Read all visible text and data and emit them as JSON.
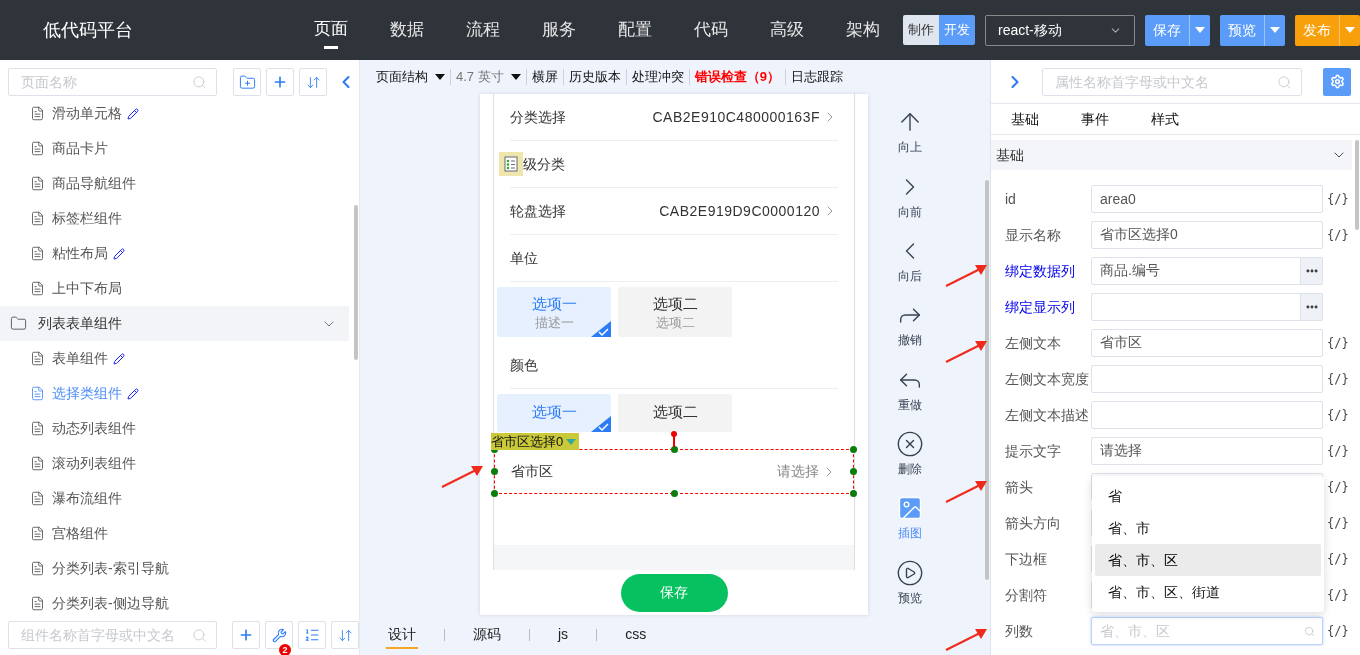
{
  "app": {
    "title": "低代码平台"
  },
  "nav": [
    {
      "label": "页面",
      "selected": true
    },
    {
      "label": "数据",
      "selected": false
    },
    {
      "label": "流程",
      "selected": false
    },
    {
      "label": "服务",
      "selected": false
    },
    {
      "label": "配置",
      "selected": false
    },
    {
      "label": "代码",
      "selected": false
    },
    {
      "label": "高级",
      "selected": false
    },
    {
      "label": "架构",
      "selected": false
    }
  ],
  "mode_toggle": [
    {
      "label": "制作",
      "selected": false
    },
    {
      "label": "开发",
      "selected": true
    }
  ],
  "platform_select": {
    "value": "react-移动"
  },
  "actions": [
    {
      "label": "保存",
      "kind": "blue"
    },
    {
      "label": "预览",
      "kind": "blue"
    },
    {
      "label": "发布",
      "kind": "orange"
    }
  ],
  "left_panel": {
    "search": {
      "placeholder": "页面名称"
    },
    "tree": [
      {
        "kind": "page",
        "label": "滑动单元格",
        "editable": true,
        "selected": false
      },
      {
        "kind": "page",
        "label": "商品卡片",
        "editable": false,
        "selected": false
      },
      {
        "kind": "page",
        "label": "商品导航组件",
        "editable": false,
        "selected": false
      },
      {
        "kind": "page",
        "label": "标签栏组件",
        "editable": false,
        "selected": false
      },
      {
        "kind": "page",
        "label": "粘性布局",
        "editable": true,
        "selected": false
      },
      {
        "kind": "page",
        "label": "上中下布局",
        "editable": false,
        "selected": false
      },
      {
        "kind": "folder",
        "label": "列表表单组件",
        "expanded": true,
        "children": [
          {
            "kind": "page",
            "label": "表单组件",
            "editable": true,
            "selected": false
          },
          {
            "kind": "page",
            "label": "选择类组件",
            "editable": true,
            "selected": true
          },
          {
            "kind": "page",
            "label": "动态列表组件",
            "editable": false,
            "selected": false
          },
          {
            "kind": "page",
            "label": "滚动列表组件",
            "editable": false,
            "selected": false
          },
          {
            "kind": "page",
            "label": "瀑布流组件",
            "editable": false,
            "selected": false
          },
          {
            "kind": "page",
            "label": "宫格组件",
            "editable": false,
            "selected": false
          },
          {
            "kind": "page",
            "label": "分类列表-索引导航",
            "editable": false,
            "selected": false
          },
          {
            "kind": "page",
            "label": "分类列表-侧边导航",
            "editable": false,
            "selected": false
          }
        ]
      }
    ],
    "component_search": {
      "placeholder": "组件名称首字母或中文名"
    },
    "tool_badge": "2"
  },
  "toolbar": [
    {
      "label": "页面结构",
      "kind": "dropdown"
    },
    {
      "label": "4.7 英寸",
      "kind": "dropdown-muted"
    },
    {
      "label": "横屏",
      "kind": "text"
    },
    {
      "label": "历史版本",
      "kind": "text"
    },
    {
      "label": "处理冲突",
      "kind": "text"
    },
    {
      "label": "错误检查（9）",
      "kind": "error"
    },
    {
      "label": "日志跟踪",
      "kind": "text"
    }
  ],
  "phone": {
    "rows": [
      {
        "kind": "picker",
        "label": "分类选择",
        "value": "CAB2E910C480000163F"
      },
      {
        "kind": "marked-label",
        "label": "级分类"
      },
      {
        "kind": "picker",
        "label": "轮盘选择",
        "value": "CAB2E919D9C0000120"
      },
      {
        "kind": "label",
        "label": "单位"
      },
      {
        "kind": "options",
        "options": [
          {
            "title": "选项一",
            "desc": "描述一",
            "selected": true
          },
          {
            "title": "选项二",
            "desc": "选项二",
            "selected": false
          }
        ]
      },
      {
        "kind": "label",
        "label": "颜色"
      },
      {
        "kind": "options",
        "options": [
          {
            "title": "选项一",
            "selected": true
          },
          {
            "title": "选项二",
            "selected": false
          }
        ]
      }
    ],
    "selected_component": {
      "tag": "省市区选择0",
      "label": "省市区",
      "placeholder": "请选择"
    },
    "save_button": "保存"
  },
  "tools": [
    {
      "label": "向上",
      "kind": "up",
      "selected": false
    },
    {
      "label": "向前",
      "kind": "forward",
      "selected": false
    },
    {
      "label": "向后",
      "kind": "back",
      "selected": false
    },
    {
      "label": "撤销",
      "kind": "undo",
      "selected": false
    },
    {
      "label": "重做",
      "kind": "redo",
      "selected": false
    },
    {
      "label": "删除",
      "kind": "delete",
      "selected": false
    },
    {
      "label": "插图",
      "kind": "image",
      "selected": true
    },
    {
      "label": "预览",
      "kind": "preview",
      "selected": false
    }
  ],
  "bottom_tabs": [
    {
      "label": "设计",
      "selected": true
    },
    {
      "label": "源码",
      "selected": false
    },
    {
      "label": "js",
      "selected": false
    },
    {
      "label": "css",
      "selected": false
    }
  ],
  "right_panel": {
    "search": {
      "placeholder": "属性名称首字母或中文名"
    },
    "tabs": [
      "基础",
      "事件",
      "样式"
    ],
    "section": {
      "title": "基础",
      "expanded": true
    },
    "properties": [
      {
        "kind": "text",
        "label": "id",
        "value": "area0",
        "expression": "{/}"
      },
      {
        "kind": "text",
        "label": "显示名称",
        "value": "省市区选择0",
        "expression": "{/}"
      },
      {
        "kind": "bind",
        "label": "绑定数据列",
        "value": "商品.编号"
      },
      {
        "kind": "bind",
        "label": "绑定显示列"
      },
      {
        "kind": "text",
        "label": "左侧文本",
        "value": "省市区",
        "expression": "{/}"
      },
      {
        "kind": "text",
        "label": "左侧文本宽度",
        "expression": "{/}"
      },
      {
        "kind": "text",
        "label": "左侧文本描述",
        "expression": "{/}"
      },
      {
        "kind": "text",
        "label": "提示文字",
        "value": "请选择",
        "expression": "{/}"
      },
      {
        "kind": "text",
        "label": "箭头",
        "expression": "{/}"
      },
      {
        "kind": "text",
        "label": "箭头方向",
        "expression": "{/}"
      },
      {
        "kind": "text",
        "label": "下边框",
        "expression": "{/}"
      },
      {
        "kind": "text",
        "label": "分割符",
        "expression": "{/}"
      },
      {
        "kind": "select",
        "label": "列数",
        "placeholder": "省、市、区",
        "expression": "{/}",
        "open": true,
        "options": [
          {
            "label": "省",
            "selected": false
          },
          {
            "label": "省、市",
            "selected": false
          },
          {
            "label": "省、市、区",
            "selected": true
          },
          {
            "label": "省、市、区、街道",
            "selected": false
          }
        ]
      }
    ]
  }
}
